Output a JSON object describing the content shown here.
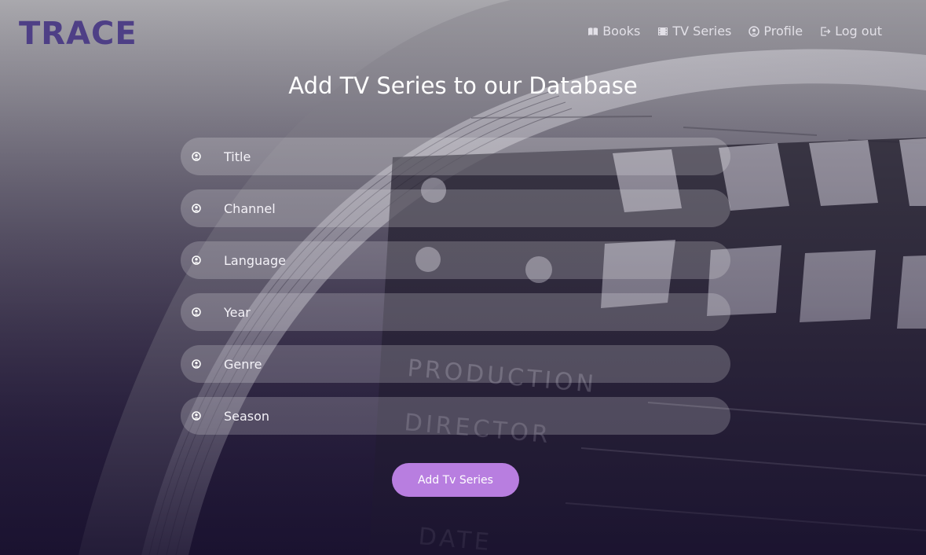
{
  "brand": {
    "logo_text": "TRACE",
    "color": "#4a3a7a"
  },
  "nav": [
    {
      "label": "Books",
      "icon": "book-icon"
    },
    {
      "label": "TV Series",
      "icon": "film-icon"
    },
    {
      "label": "Profile",
      "icon": "user-icon"
    },
    {
      "label": "Log out",
      "icon": "logout-icon"
    }
  ],
  "page": {
    "title": "Add TV Series to our Database"
  },
  "form": {
    "fields": [
      {
        "placeholder": "Title",
        "icon": "user-icon"
      },
      {
        "placeholder": "Channel",
        "icon": "user-icon"
      },
      {
        "placeholder": "Language",
        "icon": "user-icon"
      },
      {
        "placeholder": "Year",
        "icon": "user-icon"
      },
      {
        "placeholder": "Genre",
        "icon": "user-icon"
      },
      {
        "placeholder": "Season",
        "icon": "user-icon"
      }
    ],
    "submit_label": "Add Tv Series"
  },
  "colors": {
    "accent": "#b87ee0",
    "field_bg": "rgba(255,255,255,0.20)",
    "text": "#ffffff"
  }
}
